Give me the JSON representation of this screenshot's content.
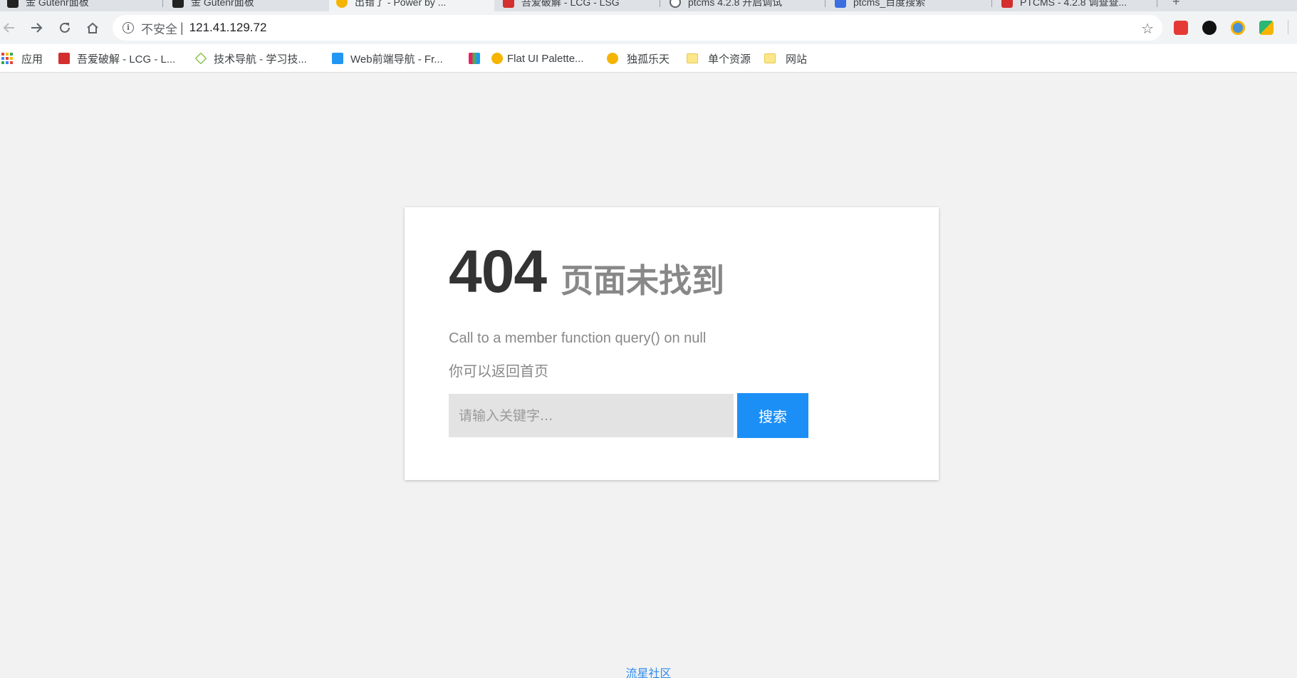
{
  "browser": {
    "tabs": [
      {
        "label": "金 Gutenr面板",
        "active": false,
        "favicon_color": "#222222"
      },
      {
        "label": "金 Gutenr面板",
        "active": false,
        "favicon_color": "#222222"
      },
      {
        "label": "出错了 - Power by ...",
        "active": true,
        "favicon_color": "#f5b400"
      },
      {
        "label": "吾爱破解 - LCG - LSG",
        "active": false,
        "favicon_color": "#d32f2f"
      },
      {
        "label": "ptcms 4.2.8 开启调试",
        "active": false,
        "favicon_color": "#5f6368"
      },
      {
        "label": "ptcms_百度搜索",
        "active": false,
        "favicon_color": "#3b6fe0"
      },
      {
        "label": "PTCMS - 4.2.8 调查查...",
        "active": false,
        "favicon_color": "#d32f2f"
      }
    ],
    "new_tab_label": "+",
    "address": {
      "security_label": "不安全",
      "url": "121.41.129.72"
    },
    "extensions": [
      {
        "name": "ext-red-icon",
        "color": "#e53935"
      },
      {
        "name": "ext-black-icon",
        "color": "#111111"
      },
      {
        "name": "ext-shield-icon",
        "color": "#4a90d9"
      },
      {
        "name": "ext-colorful-icon",
        "color": "#2bb673"
      }
    ],
    "bookmarks": [
      {
        "label": "应用",
        "icon": "apps-grid-icon"
      },
      {
        "label": "吾爱破解 - LCG - L...",
        "icon": "site-red-icon",
        "color": "#d32f2f"
      },
      {
        "label": "技术导航 - 学习技...",
        "icon": "diamond-icon",
        "color": "#8bc34a"
      },
      {
        "label": "Web前端导航 - Fr...",
        "icon": "code-icon",
        "color": "#2196f3"
      },
      {
        "label": "",
        "icon": "palette-block-icon",
        "color": "#e91e63"
      },
      {
        "label": "Flat UI Palette...",
        "icon": "palette-icon",
        "color": "#f5b400"
      },
      {
        "label": "独孤乐天",
        "icon": "robot-icon",
        "color": "#f5b400"
      },
      {
        "label": "单个资源",
        "icon": "folder-icon"
      },
      {
        "label": "网站",
        "icon": "folder-icon"
      }
    ]
  },
  "error_page": {
    "code": "404",
    "title": "页面未找到",
    "message": "Call to a member function query() on null",
    "back_text": "你可以返回首页",
    "search_placeholder": "请输入关键字...",
    "search_button": "搜索",
    "footer_link": "流星社区",
    "accent_color": "#1c8ff7"
  }
}
